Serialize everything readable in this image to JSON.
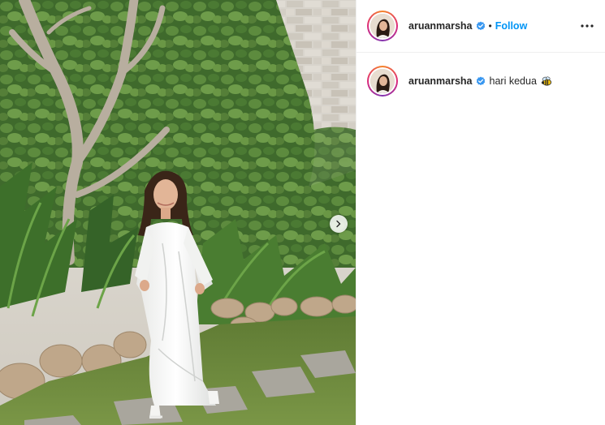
{
  "post": {
    "username": "aruanmarsha",
    "verified": true,
    "separator": "•",
    "follow_label": "Follow",
    "more_icon": "more-options-icon",
    "caption": {
      "username": "aruanmarsha",
      "text": "hari kedua",
      "emoji": "bee-emoji"
    },
    "carousel_next_icon": "chevron-right-icon"
  },
  "colors": {
    "accent": "#0095f6",
    "text": "#262626",
    "border": "#efefef"
  }
}
